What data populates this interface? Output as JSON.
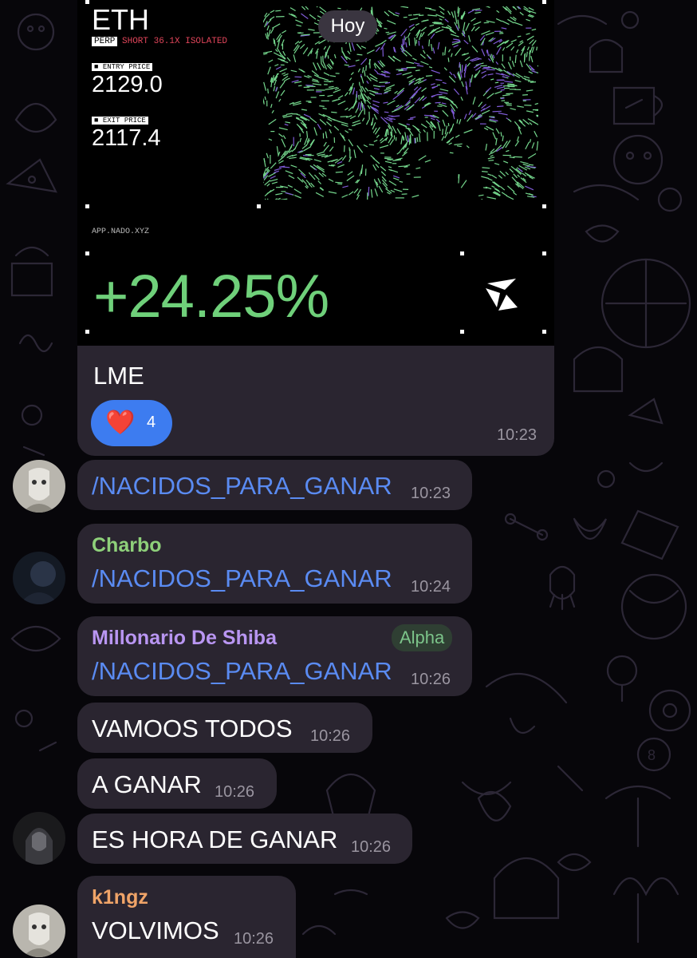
{
  "date_badge": "Hoy",
  "trade_card": {
    "asset": "ETH",
    "tag_perp": "PERP",
    "position": "SHORT 36.1X ISOLATED",
    "entry_label": "ENTRY PRICE",
    "entry_value": "2129.0",
    "exit_label": "EXIT PRICE",
    "exit_value": "2117.4",
    "site": "APP.NADO.XYZ",
    "pnl": "+24.25%",
    "pnl_color": "#6fd07a",
    "position_color": "#e0455a"
  },
  "messages": [
    {
      "text": "LME",
      "reaction_emoji": "❤️",
      "reaction_count": "4",
      "time": "10:23"
    },
    {
      "text": "/NACIDOS_PARA_GANAR",
      "time": "10:23"
    },
    {
      "sender": "Charbo",
      "sender_color": "#8ed07a",
      "text": "/NACIDOS_PARA_GANAR",
      "time": "10:24"
    },
    {
      "sender": "Millonario De Shiba",
      "sender_color": "#b996f2",
      "badge": "Alpha",
      "text": "/NACIDOS_PARA_GANAR",
      "time": "10:26"
    },
    {
      "text": "VAMOOS TODOS",
      "time": "10:26"
    },
    {
      "text": "A GANAR",
      "time": "10:26"
    },
    {
      "text": "ES HORA DE GANAR",
      "time": "10:26"
    },
    {
      "sender": "k1ngz",
      "sender_color": "#f0a468",
      "text": "VOLVIMOS",
      "time": "10:26"
    }
  ],
  "colors": {
    "bubble": "#2a2530",
    "command_link": "#5a8bf2",
    "reaction_pill": "#3d7cf0",
    "timestamp": "#9a95a0"
  }
}
